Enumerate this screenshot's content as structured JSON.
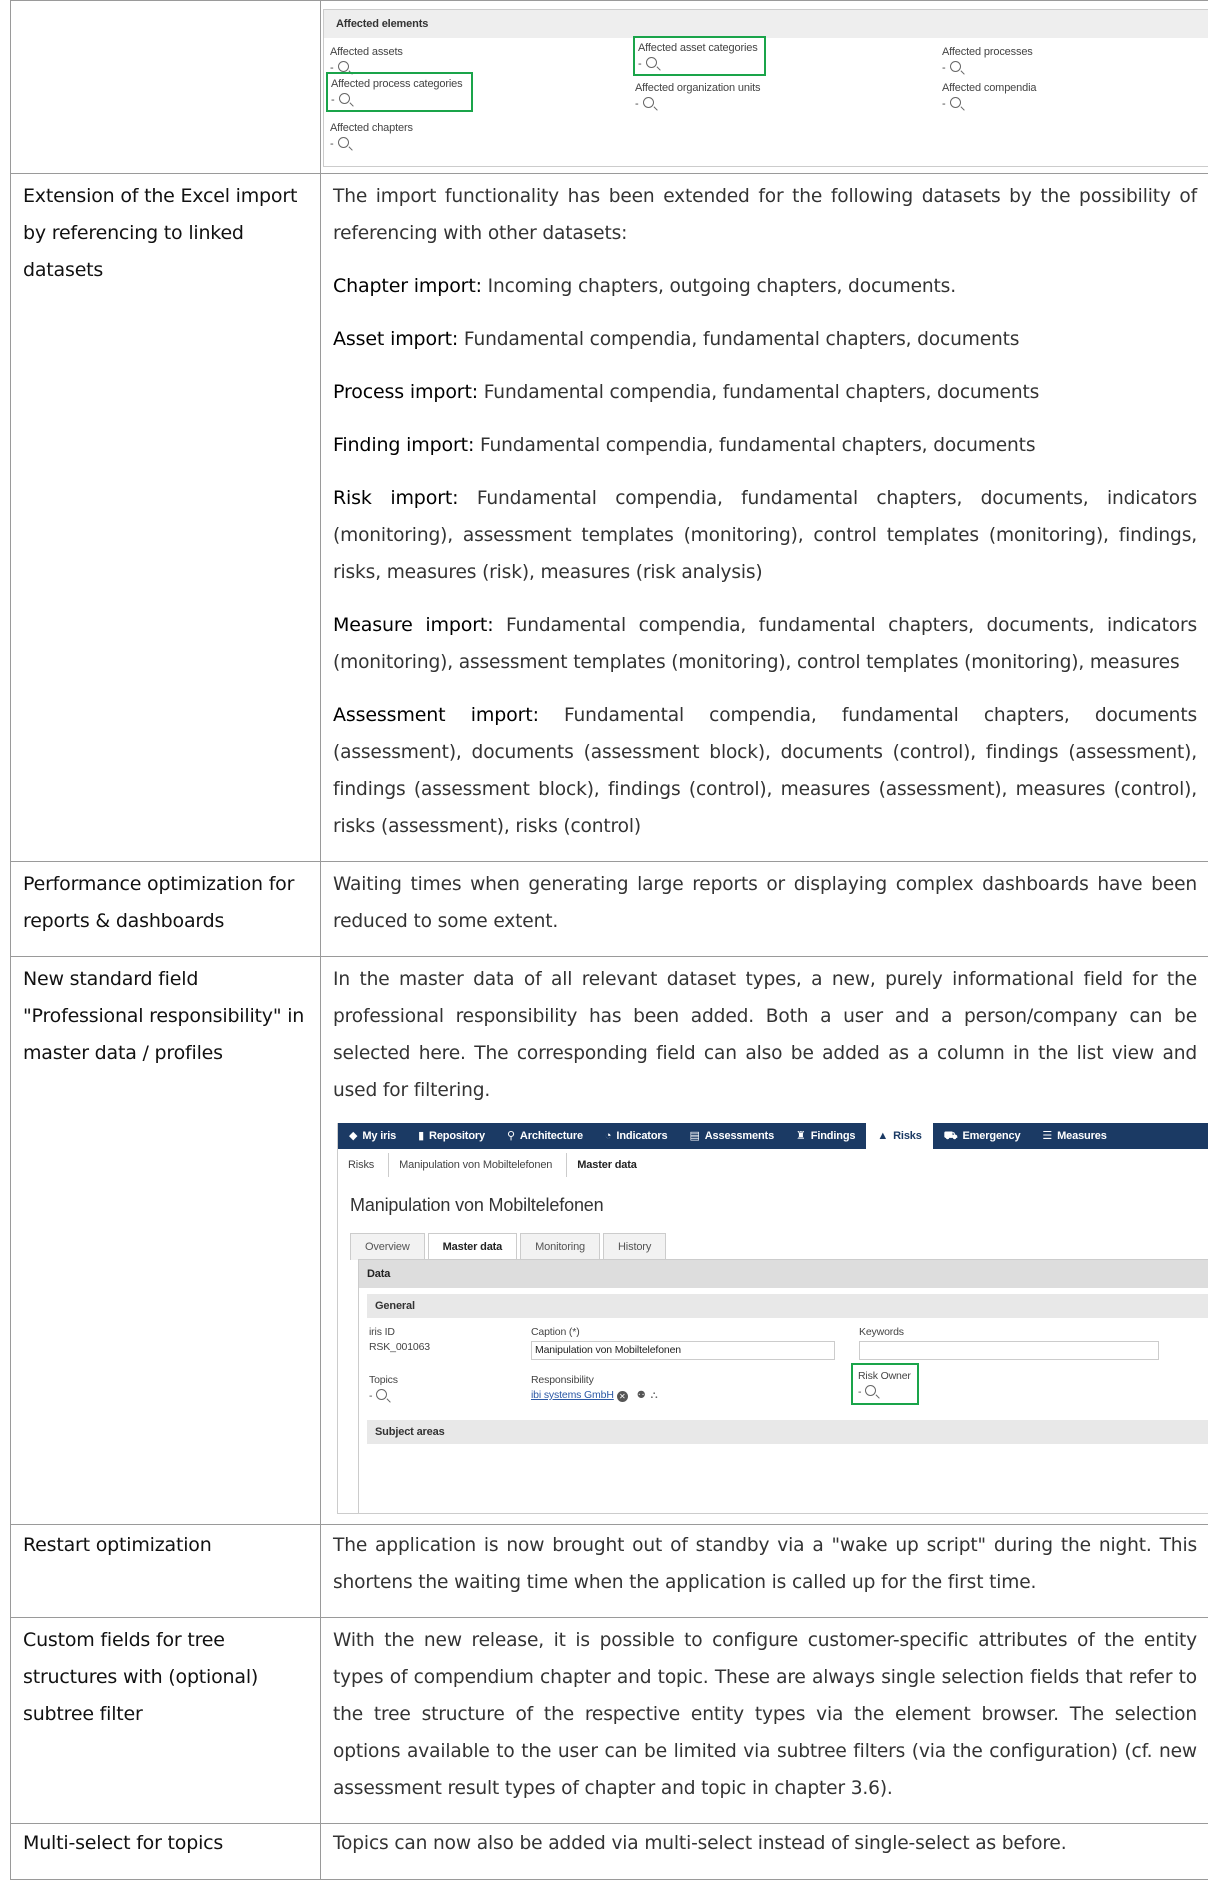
{
  "affected_elements": {
    "title": "Affected elements",
    "fields": [
      {
        "label": "Affected assets",
        "value": "-"
      },
      {
        "label": "Affected asset categories",
        "value": "-"
      },
      {
        "label": "Affected processes",
        "value": "-"
      },
      {
        "label": "Affected process categories",
        "value": "-"
      },
      {
        "label": "Affected organization units",
        "value": "-"
      },
      {
        "label": "Affected compendia",
        "value": "-"
      },
      {
        "label": "Affected chapters",
        "value": "-"
      }
    ]
  },
  "rows": [
    {
      "feature": "Extension of the Excel import by referencing to linked datasets",
      "intro": "The import functionality has been extended for the following datasets by the possibility of referencing with other datasets:",
      "items": [
        {
          "label": "Chapter import:",
          "text": " Incoming chapters, outgoing chapters, documents."
        },
        {
          "label": "Asset import:",
          "text": " Fundamental compendia, fundamental chapters, documents"
        },
        {
          "label": "Process import:",
          "text": " Fundamental compendia, fundamental chapters, documents"
        },
        {
          "label": "Finding import:",
          "text": " Fundamental compendia, fundamental chapters, documents"
        },
        {
          "label": "Risk import:",
          "text": " Fundamental compendia, fundamental chapters, documents, indicators (monitoring), assessment templates (monitoring), control templates (monitoring), findings, risks, measures (risk), measures (risk analysis)"
        },
        {
          "label": "Measure import:",
          "text": " Fundamental compendia, fundamental chapters, documents, indicators (monitoring), assessment templates (monitoring), control templates (monitoring), measures"
        },
        {
          "label": "Assessment import:",
          "text": " Fundamental compendia, fundamental chapters, documents (assessment), documents (assessment block), documents (control), findings (assessment), findings (assessment block), findings (control), measures (assessment), measures (control), risks (assessment), risks (control)"
        }
      ]
    },
    {
      "feature": "Performance optimization for reports & dashboards",
      "text": "Waiting times when generating large reports or displaying complex dashboards have been reduced to some extent."
    },
    {
      "feature": "New standard field \"Professional responsibility\" in master data / profiles",
      "text": "In the master data of all relevant dataset types, a new, purely informational field for the professional responsibility has been added. Both a user and a person/company can be selected here. The corresponding field can also be added as a column in the list view and used for filtering."
    },
    {
      "feature": "Restart optimization",
      "text": "The application is now brought out of standby via a \"wake up script\" during the night. This shortens the waiting time when the application is called up for the first time."
    },
    {
      "feature": "Custom fields for tree structures with (optional) subtree filter",
      "text": "With the new release, it is possible to configure customer-specific attributes of the entity types of compendium chapter and topic. These are always single selection fields that refer to the tree structure of the respective entity types via the element browser. The selection options available to the user can be limited via subtree filters (via the configuration) (cf. new assessment result types of chapter and topic in chapter 3.6)."
    },
    {
      "feature": "Multi-select for topics",
      "text": "Topics can now also be added via multi-select instead of single-select as before."
    }
  ],
  "iris": {
    "nav": [
      {
        "icon": "◆",
        "label": "My iris"
      },
      {
        "icon": "▮",
        "label": "Repository"
      },
      {
        "icon": "⚲",
        "label": "Architecture"
      },
      {
        "icon": "◔",
        "label": "Indicators"
      },
      {
        "icon": "▤",
        "label": "Assessments"
      },
      {
        "icon": "♜",
        "label": "Findings"
      },
      {
        "icon": "▲",
        "label": "Risks"
      },
      {
        "icon": "⛟",
        "label": "Emergency"
      },
      {
        "icon": "☰",
        "label": "Measures"
      }
    ],
    "breadcrumb": [
      "Risks",
      "Manipulation von Mobiltelefonen",
      "Master data"
    ],
    "title": "Manipulation von Mobiltelefonen",
    "tabs": [
      "Overview",
      "Master data",
      "Monitoring",
      "History"
    ],
    "data_header": "Data",
    "general_header": "General",
    "iris_id_label": "iris ID",
    "iris_id_value": "RSK_001063",
    "caption_label": "Caption (*)",
    "caption_value": "Manipulation von Mobiltelefonen",
    "keywords_label": "Keywords",
    "topics_label": "Topics",
    "topics_value": "-",
    "responsibility_label": "Responsibility",
    "responsibility_value": "ibi systems GmbH",
    "risk_owner_label": "Risk Owner",
    "risk_owner_value": "-",
    "subject_areas_header": "Subject areas"
  }
}
